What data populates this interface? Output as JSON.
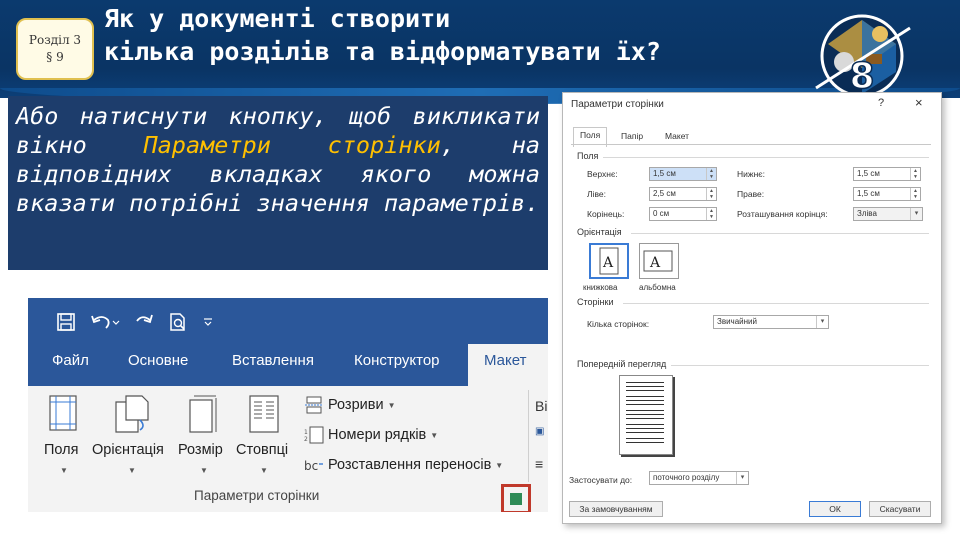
{
  "header": {
    "badge_line1": "Розділ 3",
    "badge_line2": "§ 9",
    "title_line1": "Як у документі створити",
    "title_line2": "кілька розділів та відформатувати їх?",
    "grade": "8"
  },
  "info": {
    "part1": "Або натиснути кнопку, щоб викликати вікно ",
    "highlight": "Параметри сторінки",
    "part2": ", на відповідних вкладках якого можна вказати потрібні значення параметрів."
  },
  "ribbon": {
    "tabs": [
      "Файл",
      "Основне",
      "Вставлення",
      "Конструктор"
    ],
    "active_tab": "Макет",
    "buttons": [
      "Поля",
      "Орієнтація",
      "Розмір",
      "Стовпці"
    ],
    "rows": [
      "Розриви",
      "Номери рядків",
      "Розставлення переносів"
    ],
    "group_label": "Параметри сторінки",
    "partial_letter": "Ві"
  },
  "dialog": {
    "title": "Параметри сторінки",
    "help": "?",
    "close": "×",
    "tabs": [
      "Поля",
      "Папір",
      "Макет"
    ],
    "margins_section": "Поля",
    "top_label": "Верхнє:",
    "top_value": "1,5 см",
    "left_label": "Ліве:",
    "left_value": "2,5 см",
    "gutter_label": "Корінець:",
    "gutter_value": "0 см",
    "bottom_label": "Нижнє:",
    "bottom_value": "1,5 см",
    "right_label": "Праве:",
    "right_value": "1,5 см",
    "gutter_pos_label": "Розташування корінця:",
    "gutter_pos_value": "Зліва",
    "orientation_section": "Орієнтація",
    "portrait": "книжкова",
    "landscape": "альбомна",
    "pages_section": "Сторінки",
    "multiple_pages_label": "Кілька сторінок:",
    "multiple_pages_value": "Звичайний",
    "preview_section": "Попередній перегляд",
    "apply_label": "Застосувати до:",
    "apply_value": "поточного розділу",
    "default_button": "За замовчуванням",
    "ok_button": "ОК",
    "cancel_button": "Скасувати"
  }
}
